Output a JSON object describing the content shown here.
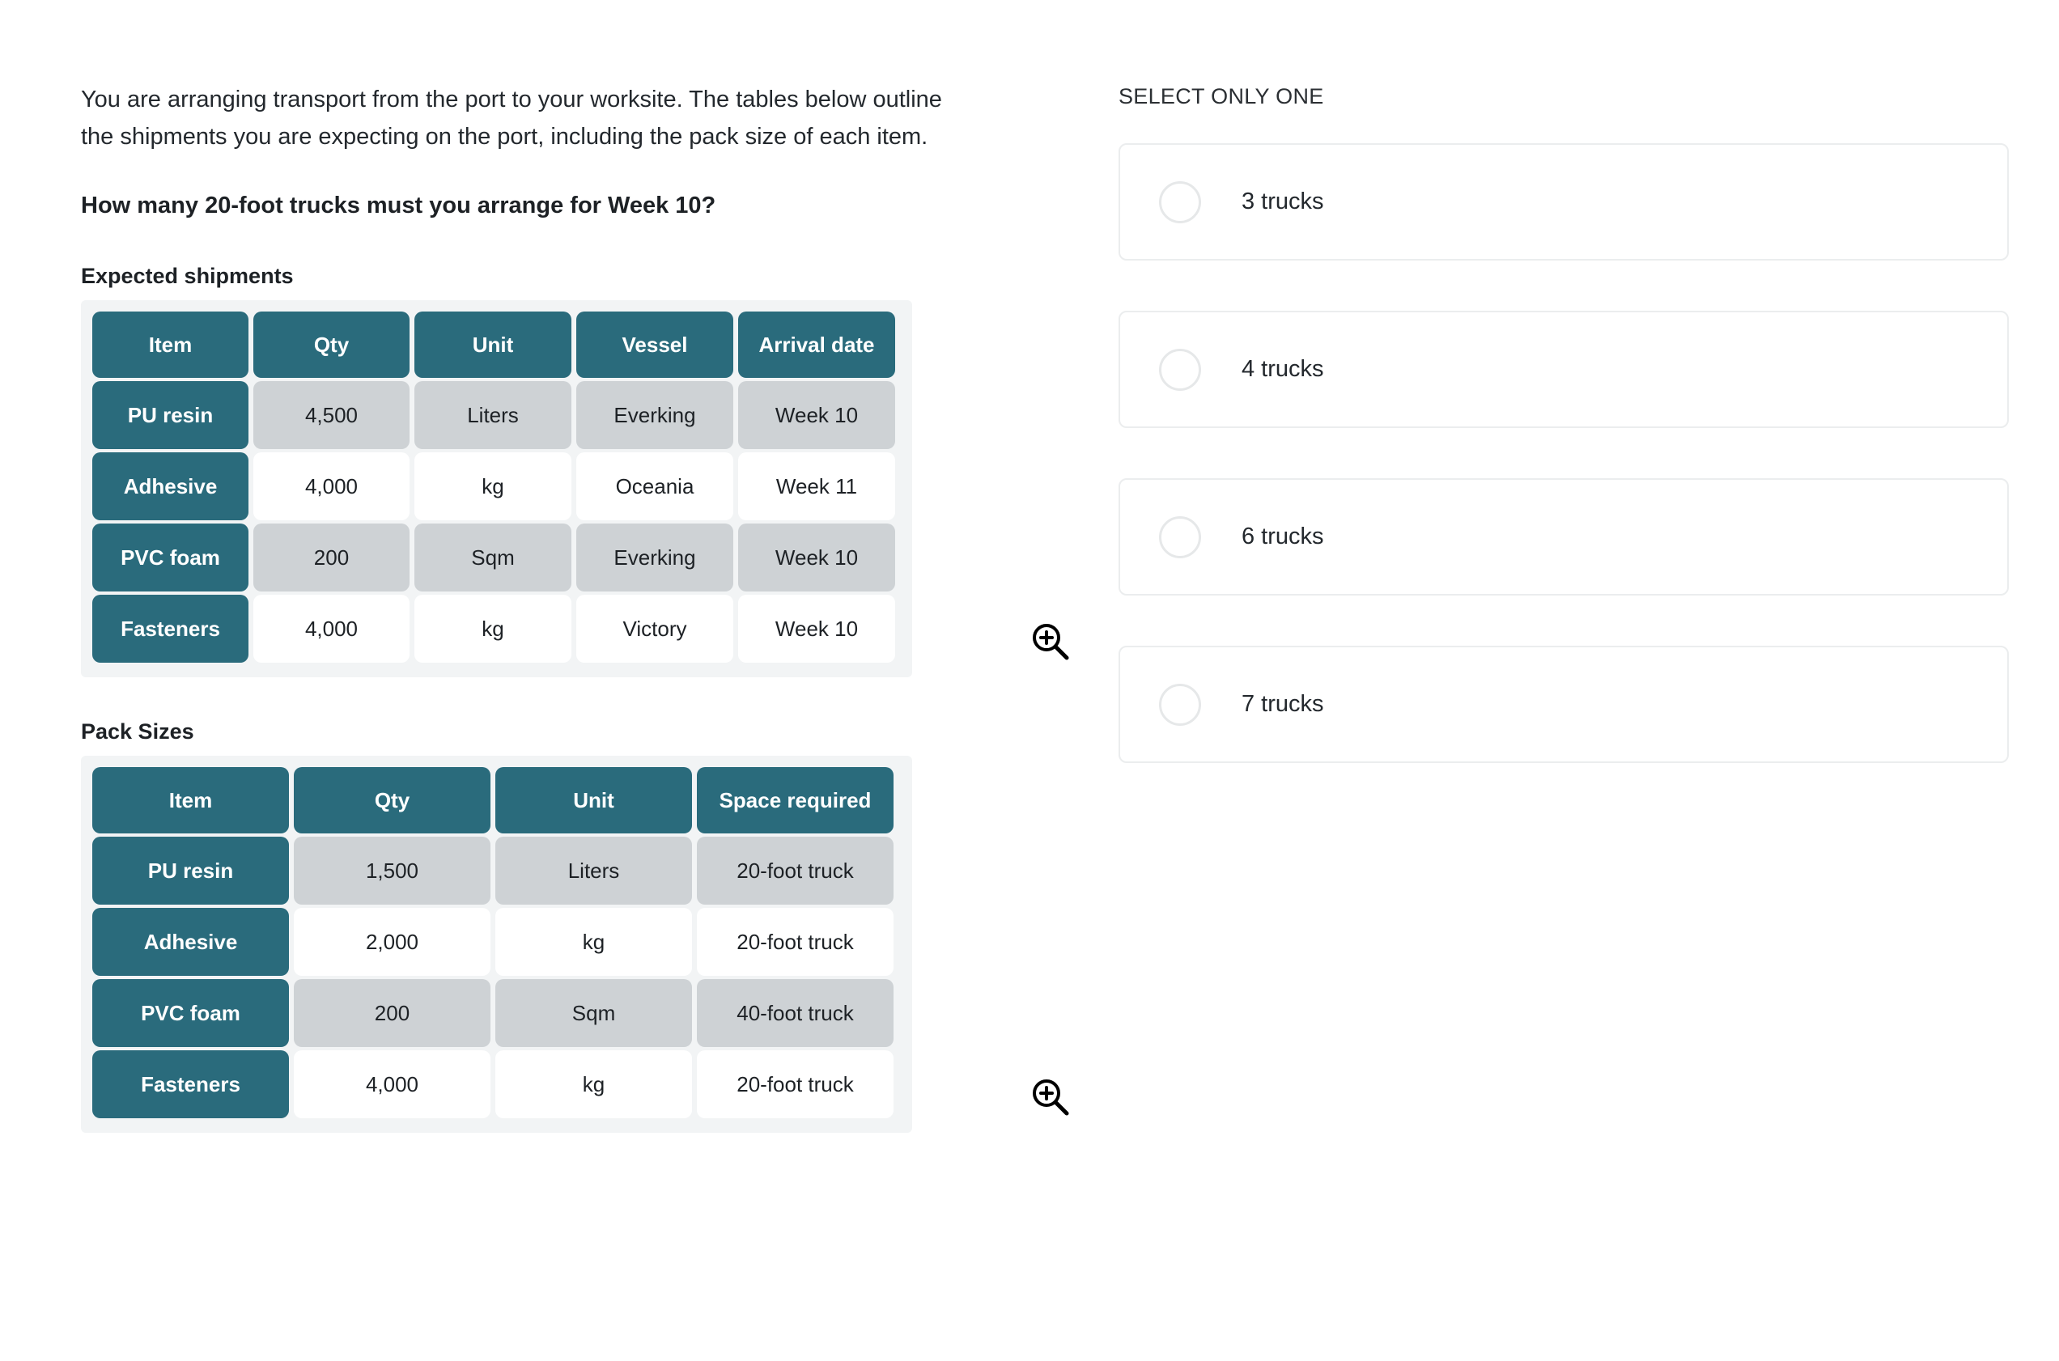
{
  "left": {
    "intro": "You are arranging transport from the port to your worksite. The tables below outline the shipments you are expecting on the port, including the pack size of each item.",
    "question": "How many 20-foot trucks must you arrange for Week 10?",
    "shipments_heading": "Expected shipments",
    "pack_heading": "Pack Sizes",
    "zoom_icon_name": "zoom-in-icon"
  },
  "shipments_table": {
    "columns": [
      "Item",
      "Qty",
      "Unit",
      "Vessel",
      "Arrival date"
    ],
    "rows": [
      [
        "PU resin",
        "4,500",
        "Liters",
        "Everking",
        "Week 10"
      ],
      [
        "Adhesive",
        "4,000",
        "kg",
        "Oceania",
        "Week 11"
      ],
      [
        "PVC foam",
        "200",
        "Sqm",
        "Everking",
        "Week 10"
      ],
      [
        "Fasteners",
        "4,000",
        "kg",
        "Victory",
        "Week 10"
      ]
    ]
  },
  "pack_table": {
    "columns": [
      "Item",
      "Qty",
      "Unit",
      "Space required"
    ],
    "rows": [
      [
        "PU resin",
        "1,500",
        "Liters",
        "20-foot truck"
      ],
      [
        "Adhesive",
        "2,000",
        "kg",
        "20-foot truck"
      ],
      [
        "PVC foam",
        "200",
        "Sqm",
        "40-foot truck"
      ],
      [
        "Fasteners",
        "4,000",
        "kg",
        "20-foot truck"
      ]
    ]
  },
  "right": {
    "select_label": "SELECT ONLY ONE",
    "options": [
      {
        "label": "3 trucks",
        "selected": false
      },
      {
        "label": "4 trucks",
        "selected": false
      },
      {
        "label": "6 trucks",
        "selected": false
      },
      {
        "label": "7 trucks",
        "selected": false
      }
    ]
  },
  "colors": {
    "header_teal": "#2a6b7c",
    "alt_row_gray": "#ced2d5",
    "table_bg": "#f2f4f5",
    "text": "#23282d",
    "card_border": "#ebedee"
  }
}
